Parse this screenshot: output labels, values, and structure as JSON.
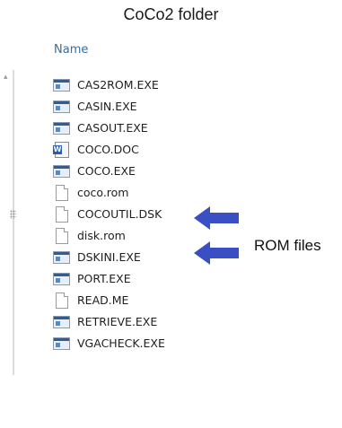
{
  "title": "CoCo2 folder",
  "column_header": "Name",
  "files": [
    {
      "name": "CAS2ROM.EXE",
      "icon": "exe-icon"
    },
    {
      "name": "CASIN.EXE",
      "icon": "exe-icon"
    },
    {
      "name": "CASOUT.EXE",
      "icon": "exe-icon"
    },
    {
      "name": "COCO.DOC",
      "icon": "word-doc-icon"
    },
    {
      "name": "COCO.EXE",
      "icon": "exe-icon"
    },
    {
      "name": "coco.rom",
      "icon": "file-icon"
    },
    {
      "name": "COCOUTIL.DSK",
      "icon": "file-icon"
    },
    {
      "name": "disk.rom",
      "icon": "file-icon"
    },
    {
      "name": "DSKINI.EXE",
      "icon": "exe-icon"
    },
    {
      "name": "PORT.EXE",
      "icon": "exe-icon"
    },
    {
      "name": "READ.ME",
      "icon": "file-icon"
    },
    {
      "name": "RETRIEVE.EXE",
      "icon": "exe-icon"
    },
    {
      "name": "VGACHECK.EXE",
      "icon": "exe-icon"
    }
  ],
  "annotation": {
    "label": "ROM files",
    "arrow_color": "#3a4fc4"
  }
}
